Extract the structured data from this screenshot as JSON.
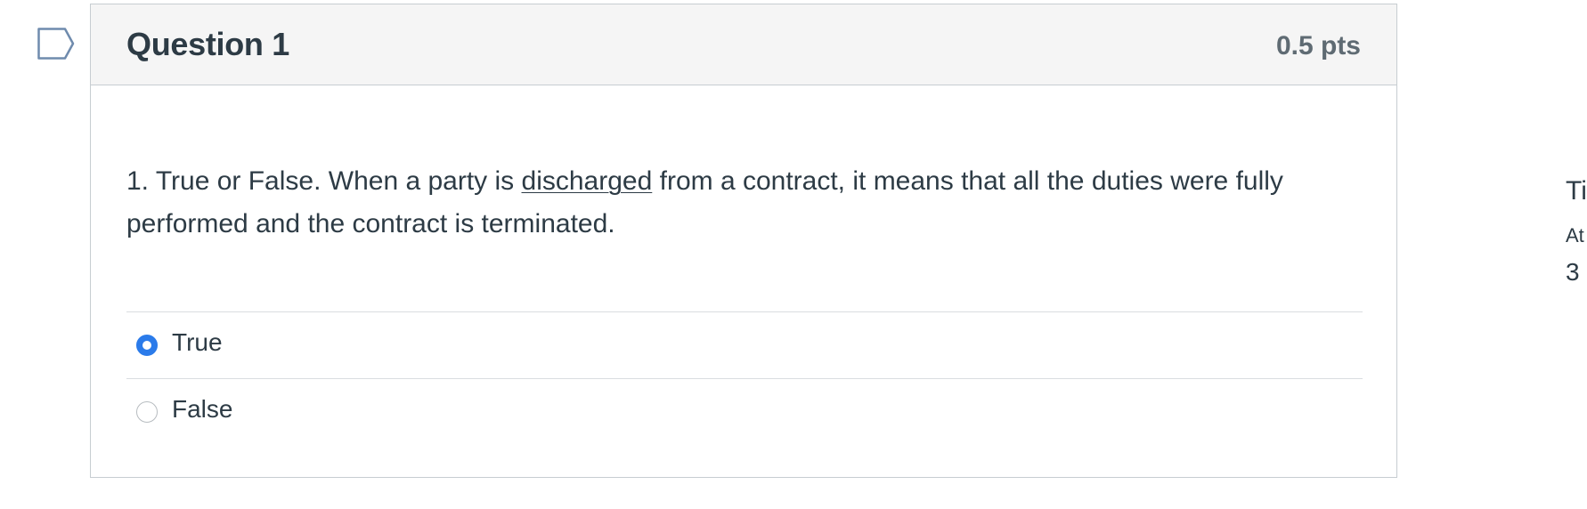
{
  "question": {
    "title": "Question 1",
    "points": "0.5 pts",
    "text_before": "1. True or False. When a party is ",
    "text_underlined": "discharged",
    "text_after": " from a contract, it means that all the duties were fully performed and the contract is terminated.",
    "answers": [
      {
        "label": "True",
        "selected": true
      },
      {
        "label": "False",
        "selected": false
      }
    ]
  },
  "side_panel": {
    "title_fragment": "Ti",
    "sub_fragment": "At",
    "number_fragment": "3"
  },
  "colors": {
    "accent": "#2b7bea",
    "header_bg": "#f5f5f5",
    "border": "#c7cdd1",
    "text": "#2d3b45"
  },
  "icons": {
    "flag": "flag-question-icon"
  }
}
